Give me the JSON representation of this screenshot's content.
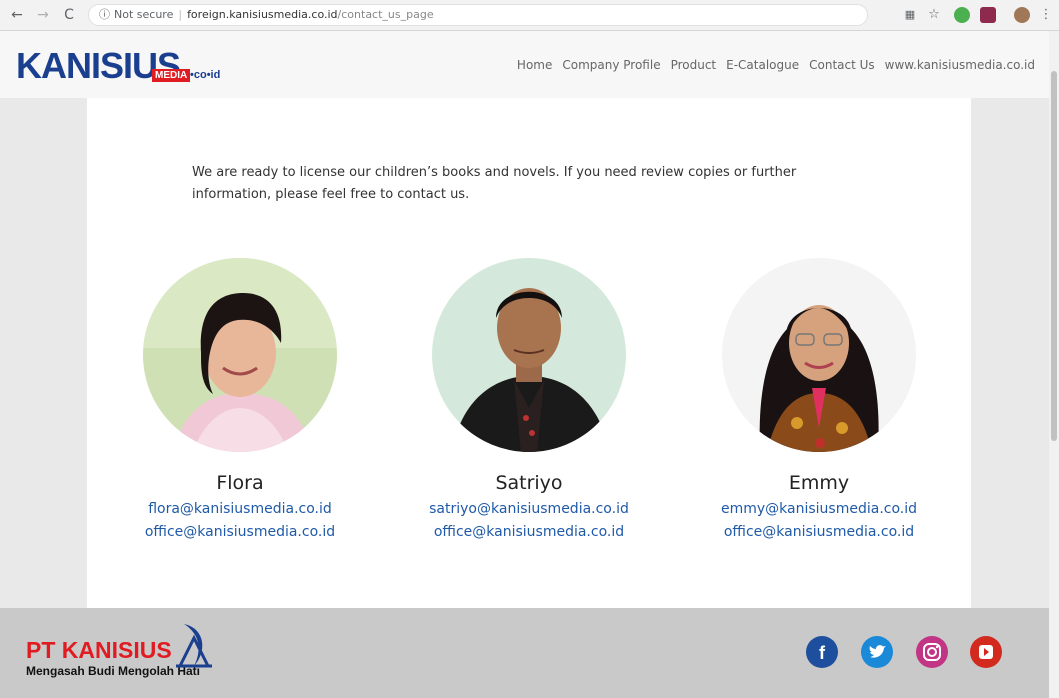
{
  "browser": {
    "security": "Not secure",
    "url_host": "foreign.kanisiusmedia.co.id",
    "url_path": "/contact_us_page"
  },
  "site": {
    "logo_main": "KANISIUS",
    "logo_media": "MEDIA",
    "logo_suffix": "•co•id",
    "nav": [
      "Home",
      "Company Profile",
      "Product",
      "E-Catalogue",
      "Contact Us",
      "www.kanisiusmedia.co.id"
    ]
  },
  "intro": "We are ready to license our children’s books and novels. If you need review copies or further information, please feel free to contact us.",
  "contacts": [
    {
      "name": "Flora",
      "email": "flora@kanisiusmedia.co.id",
      "office": "office@kanisiusmedia.co.id"
    },
    {
      "name": "Satriyo",
      "email": "satriyo@kanisiusmedia.co.id",
      "office": "office@kanisiusmedia.co.id"
    },
    {
      "name": "Emmy",
      "email": "emmy@kanisiusmedia.co.id",
      "office": "office@kanisiusmedia.co.id"
    }
  ],
  "footer": {
    "logo": "PT KANISIUS",
    "tagline": "Mengasah Budi Mengolah Hati",
    "social": [
      "facebook-icon",
      "twitter-icon",
      "instagram-icon",
      "youtube-icon"
    ]
  },
  "colors": {
    "brand_blue": "#1b3f8f",
    "brand_red": "#e11b22",
    "link_blue": "#1f5aa8"
  }
}
